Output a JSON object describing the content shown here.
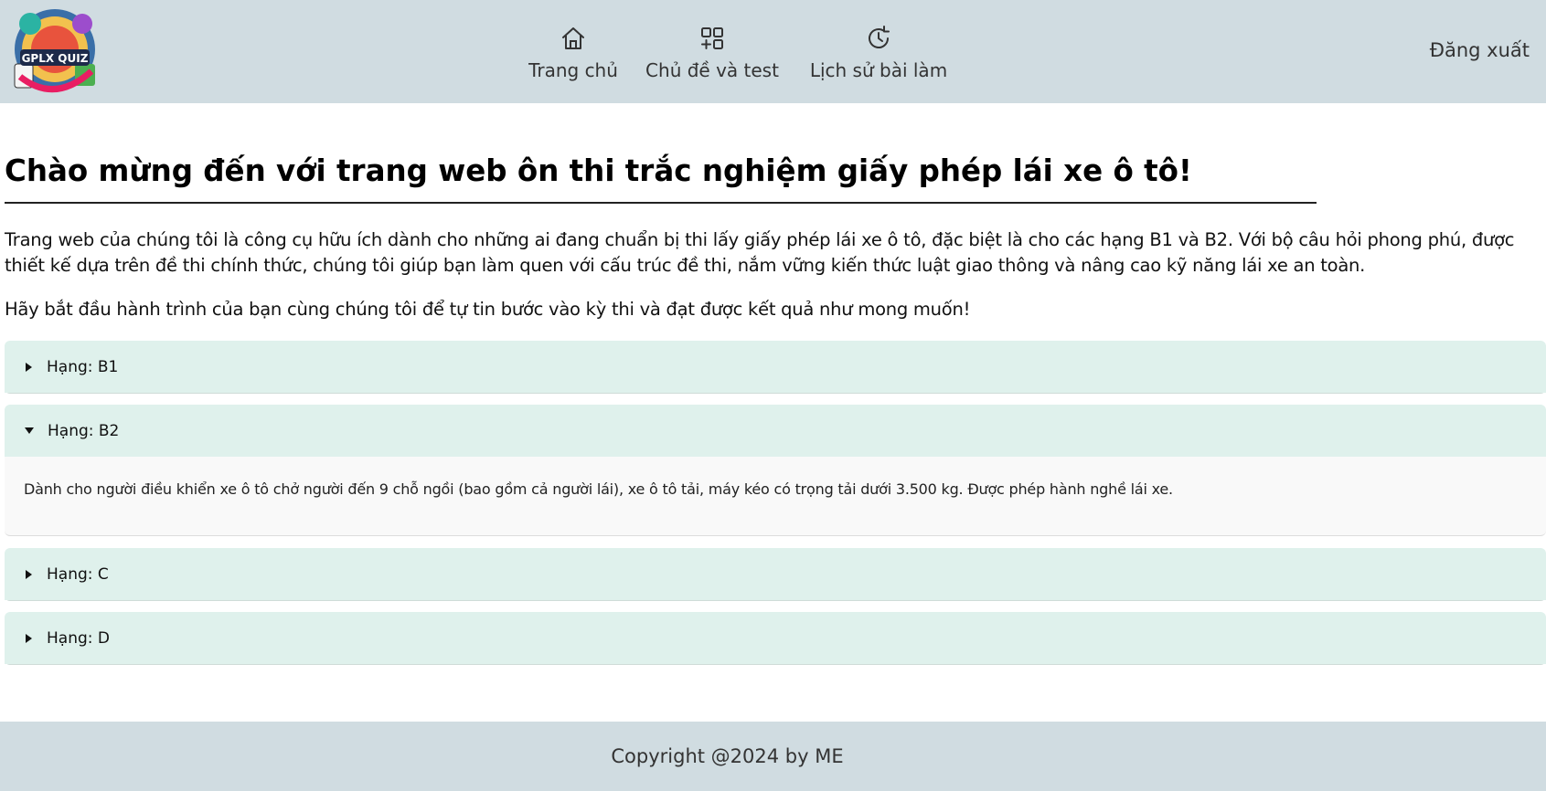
{
  "header": {
    "logo_text": "GPLX QUIZ",
    "nav": [
      {
        "label": "Trang chủ",
        "icon": "home-icon"
      },
      {
        "label": "Chủ đề và test",
        "icon": "grid-add-icon"
      },
      {
        "label": "Lịch sử bài làm",
        "icon": "history-icon"
      }
    ],
    "logout_label": "Đăng xuất"
  },
  "main": {
    "title": "Chào mừng đến với trang web ôn thi trắc nghiệm giấy phép lái xe ô tô!",
    "intro": "Trang web của chúng tôi là công cụ hữu ích dành cho những ai đang chuẩn bị thi lấy giấy phép lái xe ô tô, đặc biệt là cho các hạng B1 và B2. Với bộ câu hỏi phong phú, được thiết kế dựa trên đề thi chính thức, chúng tôi giúp bạn làm quen với cấu trúc đề thi, nắm vững kiến thức luật giao thông và nâng cao kỹ năng lái xe an toàn.",
    "intro2": "Hãy bắt đầu hành trình của bạn cùng chúng tôi để tự tin bước vào kỳ thi và đạt được kết quả như mong muốn!"
  },
  "accordion": [
    {
      "label": "Hạng: B1",
      "expanded": false
    },
    {
      "label": "Hạng: B2",
      "expanded": true,
      "content": "Dành cho người điều khiển xe ô tô chở người đến 9 chỗ ngồi (bao gồm cả người lái), xe ô tô tải, máy kéo có trọng tải dưới 3.500 kg. Được phép hành nghề lái xe."
    },
    {
      "label": "Hạng: C",
      "expanded": false
    },
    {
      "label": "Hạng: D",
      "expanded": false
    }
  ],
  "footer": {
    "copyright": "Copyright @2024 by ME"
  },
  "colors": {
    "header_bg": "#d0dce1",
    "accordion_header_bg": "#dff1ec",
    "accordion_body_bg": "#f9f9f9"
  }
}
